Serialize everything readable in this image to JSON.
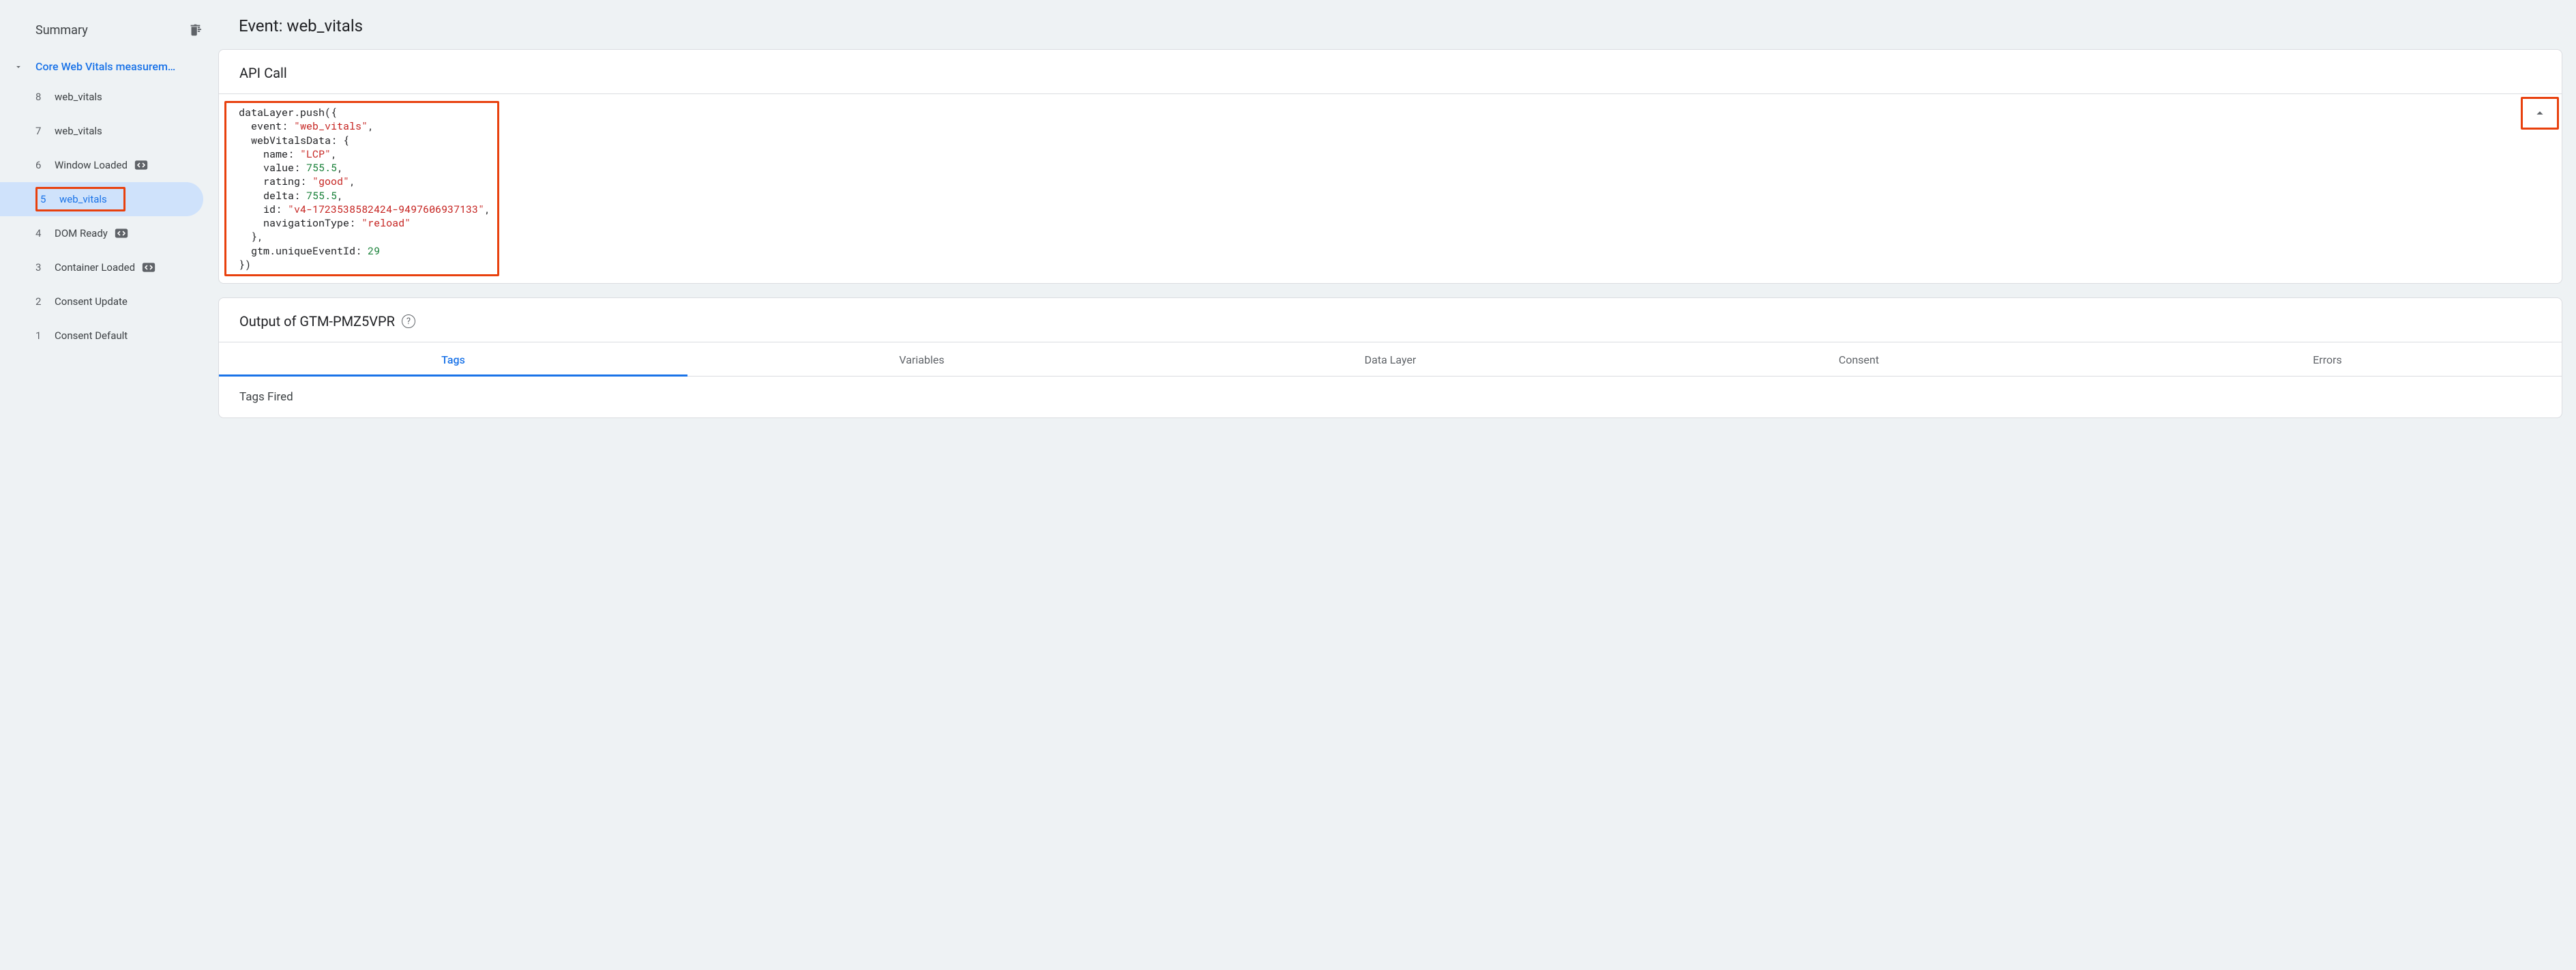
{
  "sidebar": {
    "title": "Summary",
    "group_label": "Core Web Vitals measurem…",
    "events": [
      {
        "num": "8",
        "label": "web_vitals",
        "icon": null,
        "selected": false
      },
      {
        "num": "7",
        "label": "web_vitals",
        "icon": null,
        "selected": false
      },
      {
        "num": "6",
        "label": "Window Loaded",
        "icon": "code-icon",
        "selected": false
      },
      {
        "num": "5",
        "label": "web_vitals",
        "icon": null,
        "selected": true,
        "highlight": true
      },
      {
        "num": "4",
        "label": "DOM Ready",
        "icon": "code-icon",
        "selected": false
      },
      {
        "num": "3",
        "label": "Container Loaded",
        "icon": "code-icon",
        "selected": false
      },
      {
        "num": "2",
        "label": "Consent Update",
        "icon": null,
        "selected": false
      },
      {
        "num": "1",
        "label": "Consent Default",
        "icon": null,
        "selected": false
      }
    ]
  },
  "main": {
    "title": "Event: web_vitals",
    "api_card_title": "API Call",
    "code": {
      "fn": "dataLayer.push",
      "event_key": "event",
      "event_val": "\"web_vitals\"",
      "obj_key": "webVitalsData",
      "name_key": "name",
      "name_val": "\"LCP\"",
      "value_key": "value",
      "value_val": "755.5",
      "rating_key": "rating",
      "rating_val": "\"good\"",
      "delta_key": "delta",
      "delta_val": "755.5",
      "id_key": "id",
      "id_val": "\"v4-1723538582424-9497606937133\"",
      "nav_key": "navigationType",
      "nav_val": "\"reload\"",
      "gtm_key": "gtm.uniqueEventId",
      "gtm_val": "29"
    },
    "output_title": "Output of GTM-PMZ5VPR",
    "tabs": [
      {
        "label": "Tags",
        "active": true
      },
      {
        "label": "Variables",
        "active": false
      },
      {
        "label": "Data Layer",
        "active": false
      },
      {
        "label": "Consent",
        "active": false
      },
      {
        "label": "Errors",
        "active": false
      }
    ],
    "tags_fired_title": "Tags Fired"
  }
}
